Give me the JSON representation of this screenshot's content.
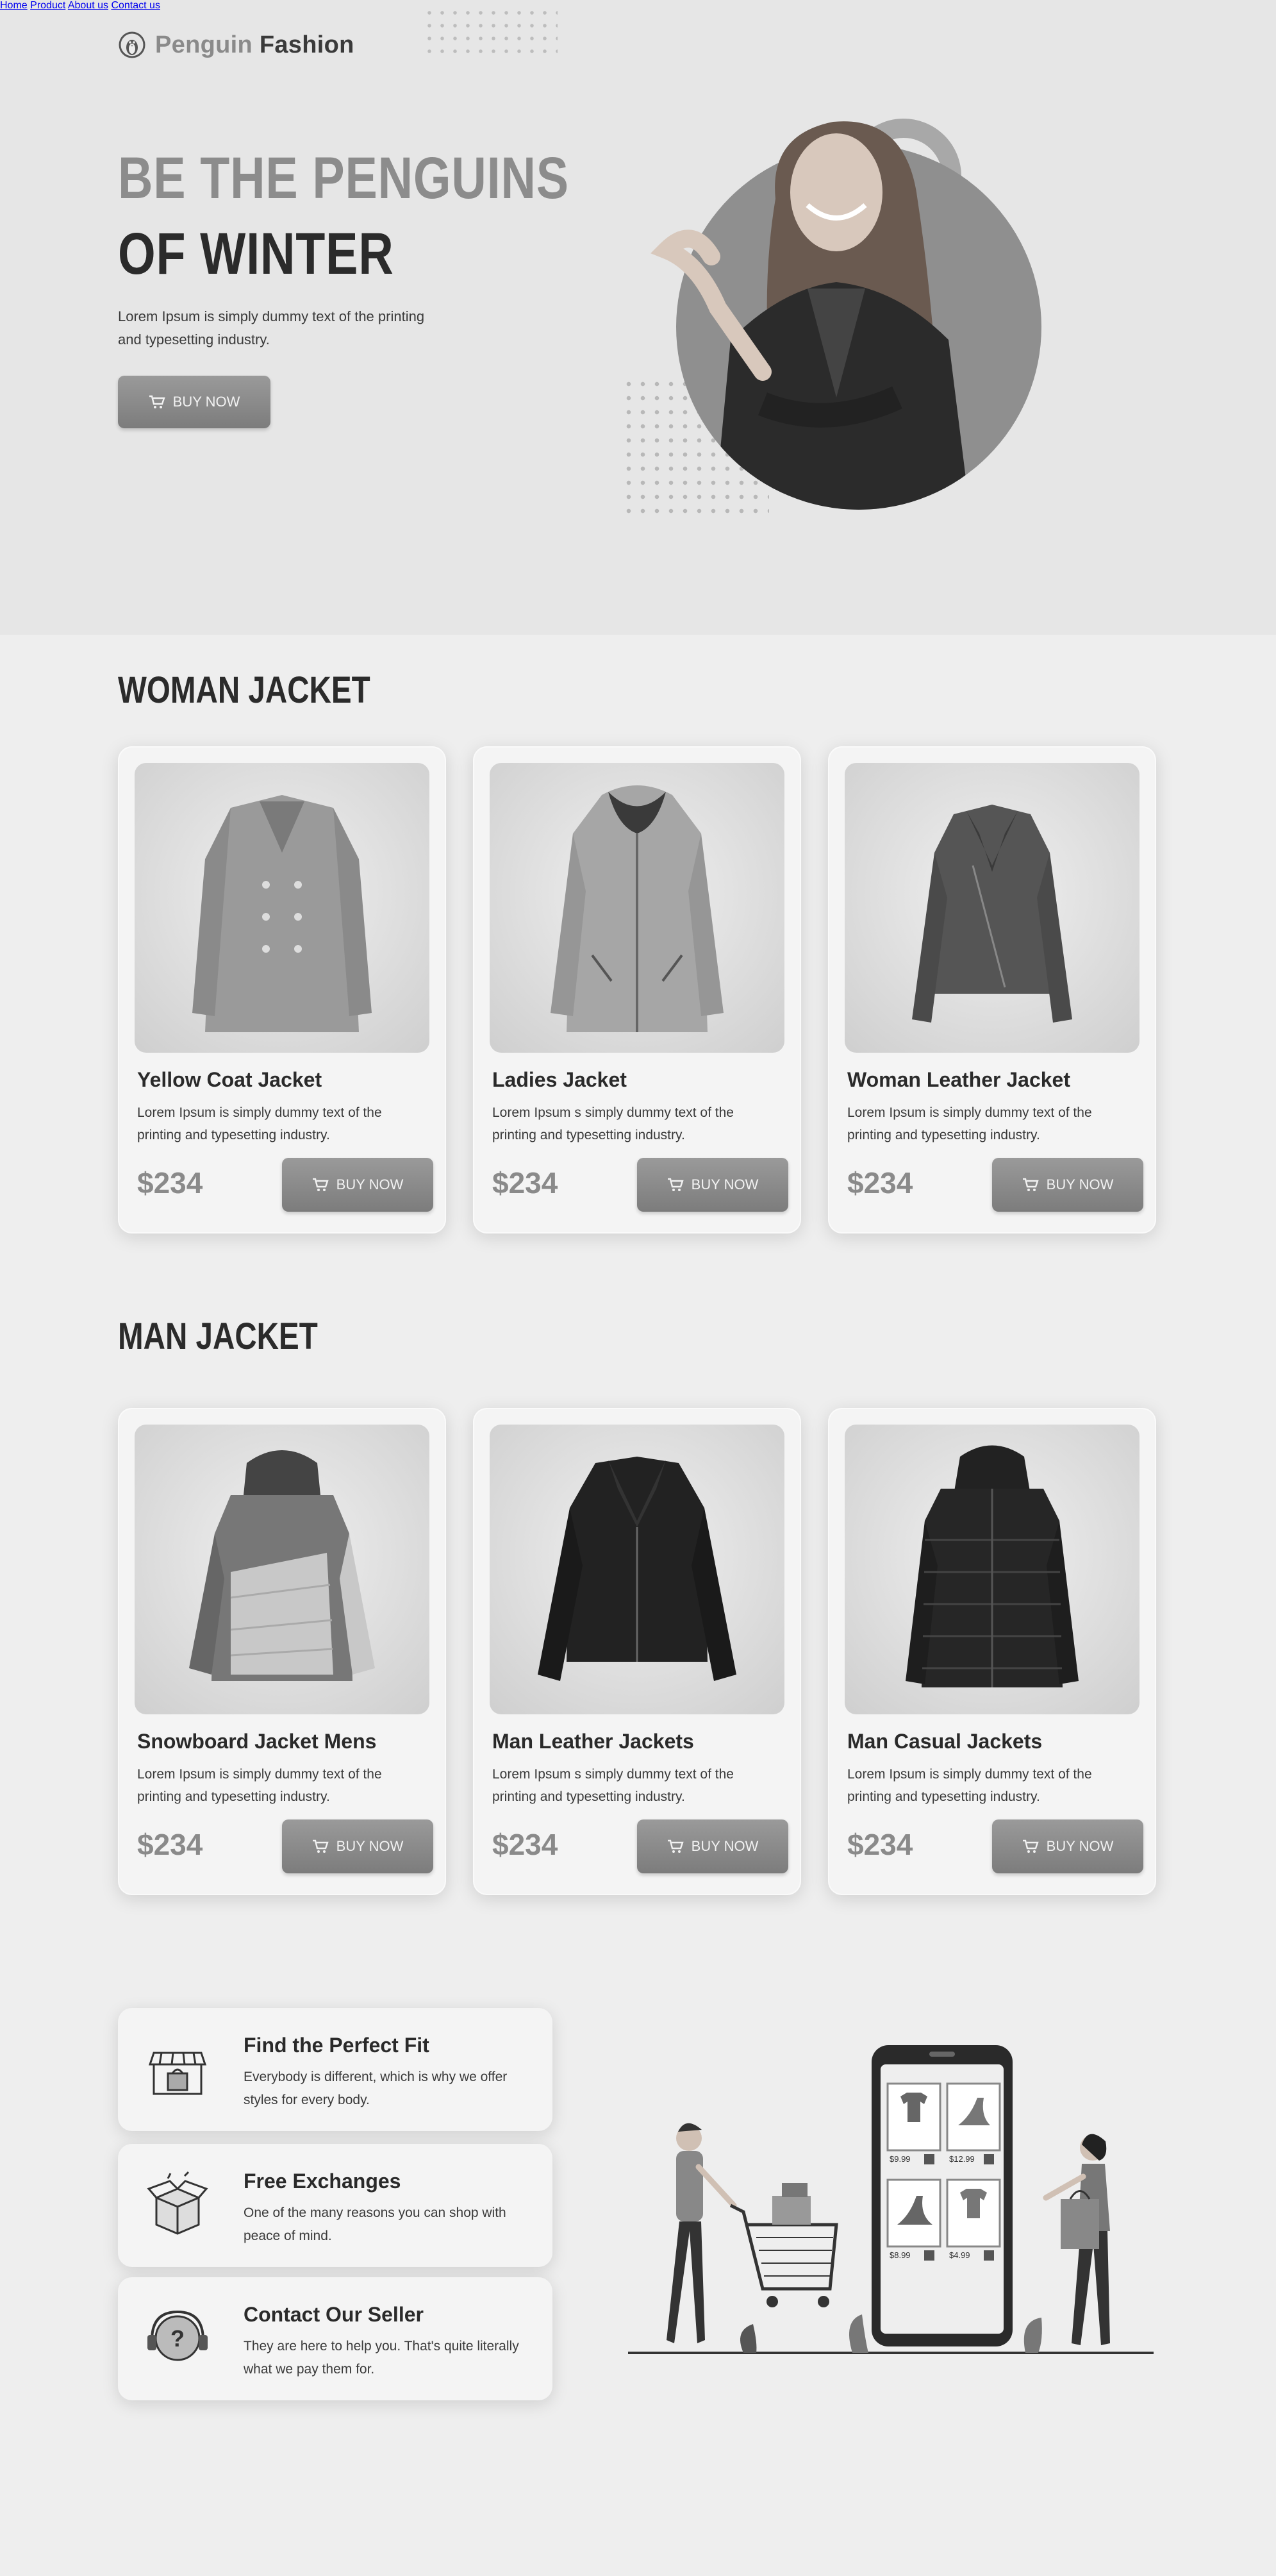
{
  "header": {
    "brand_part1": "Penguin",
    "brand_part2": "Fashion",
    "nav": [
      "Home",
      "Product",
      "About us",
      "Contact us"
    ]
  },
  "hero": {
    "title_line1": "BE THE PENGUINS",
    "title_line2": "OF WINTER",
    "description": "Lorem Ipsum is simply dummy text of the printing and typesetting industry.",
    "button_label": "BUY NOW"
  },
  "sections": {
    "woman_title": "WOMAN JACKET",
    "man_title": "MAN JACKET"
  },
  "woman_jackets": [
    {
      "title": "Yellow Coat Jacket",
      "description": "Lorem Ipsum is simply dummy text of the printing and typesetting industry.",
      "price": "$234",
      "button": "BUY NOW",
      "icon": "coat-jacket-image"
    },
    {
      "title": "Ladies Jacket",
      "description": "Lorem Ipsum  s simply dummy text of the printing and typesetting industry.",
      "price": "$234",
      "button": "BUY NOW",
      "icon": "ladies-jacket-image"
    },
    {
      "title": "Woman Leather Jacket",
      "description": "Lorem Ipsum is simply dummy text of the printing and typesetting industry.",
      "price": "$234",
      "button": "BUY NOW",
      "icon": "leather-jacket-image"
    }
  ],
  "man_jackets": [
    {
      "title": "Snowboard Jacket Mens",
      "description": "Lorem Ipsum is simply dummy text of the printing and typesetting industry.",
      "price": "$234",
      "button": "BUY NOW",
      "icon": "snowboard-jacket-image"
    },
    {
      "title": "Man Leather Jackets",
      "description": "Lorem Ipsum  s simply dummy text of the printing and typesetting industry.",
      "price": "$234",
      "button": "BUY NOW",
      "icon": "leather-jacket-image"
    },
    {
      "title": "Man Casual Jackets",
      "description": "Lorem Ipsum is simply dummy text of the printing and typesetting industry.",
      "price": "$234",
      "button": "BUY NOW",
      "icon": "puffer-jacket-image"
    }
  ],
  "features": [
    {
      "title": "Find the Perfect Fit",
      "description": "Everybody is different, which is why we offer styles for every body.",
      "icon": "store-icon"
    },
    {
      "title": "Free Exchanges",
      "description": "One of the many reasons you can shop with peace of mind.",
      "icon": "box-icon"
    },
    {
      "title": "Contact Our Seller",
      "description": "They are here to help you. That's quite literally what we pay them for.",
      "icon": "support-icon"
    }
  ],
  "illustration": {
    "prices": [
      "$9.99",
      "$12.99",
      "$8.99",
      "$4.99"
    ]
  }
}
